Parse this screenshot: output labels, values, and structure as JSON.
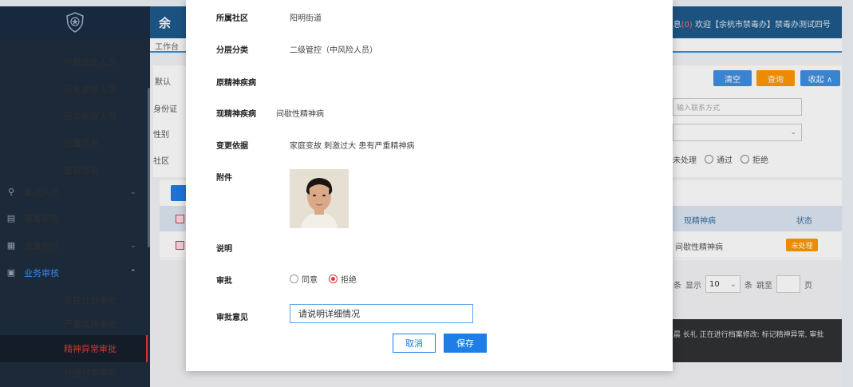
{
  "header": {
    "brand_partial": "余",
    "user_info_prefix": "息",
    "user_info_count": "(0)",
    "user_info": "欢迎【余杭市禁毒办】禁毒办测试四号"
  },
  "breadcrumb": {
    "label": "工作台"
  },
  "sidebar": {
    "items": [
      {
        "label": "户籍迁出人员",
        "kind": "sub"
      },
      {
        "label": "历年复吸人员",
        "kind": "sub"
      },
      {
        "label": "历年新增人员",
        "kind": "sub"
      },
      {
        "label": "处置信息",
        "kind": "sub"
      },
      {
        "label": "查获信息",
        "kind": "sub"
      },
      {
        "label": "重点人员",
        "kind": "top",
        "icon": "person-icon"
      },
      {
        "label": "戒毒管理",
        "kind": "top",
        "icon": "document-icon"
      },
      {
        "label": "戒毒管控",
        "kind": "top",
        "icon": "list-icon"
      },
      {
        "label": "业务审核",
        "kind": "top",
        "icon": "audit-icon"
      },
      {
        "label": "管控计划审批",
        "kind": "sub"
      },
      {
        "label": "严重疾病审批",
        "kind": "sub"
      },
      {
        "label": "精神异常审批",
        "kind": "sub"
      },
      {
        "label": "分层分类审批",
        "kind": "sub"
      }
    ]
  },
  "search": {
    "default_label": "默认",
    "id_label": "身份证",
    "gender_label": "性别",
    "community_label": "社区",
    "contact_placeholder": "输入联系方式",
    "clear_label": "清空",
    "query_label": "查询",
    "collapse_label": "收起 ∧",
    "status_options": [
      "未处理",
      "通过",
      "拒绝"
    ]
  },
  "table": {
    "columns": [
      "现精神病",
      "状态"
    ],
    "rows": [
      {
        "disease": "间歇性精神病",
        "status": "未处理"
      }
    ]
  },
  "pager": {
    "items_label": "条",
    "show_label": "显示",
    "page_size": "10",
    "items_label2": "条",
    "goto_label": "跳至",
    "page_label": "页"
  },
  "toast": {
    "text": "晨 长礼 正在进行档案修改: 标记精神异常, 审批"
  },
  "modal": {
    "fields": [
      {
        "label": "所属社区",
        "value": "阳明街道"
      },
      {
        "label": "分层分类",
        "value": "二级管控（中风险人员）"
      },
      {
        "label": "原精神疾病",
        "value": ""
      },
      {
        "label": "现精神疾病",
        "value": "间歇性精神病"
      },
      {
        "label": "变更依据",
        "value": "家庭变故 刺激过大 患有严重精神病"
      }
    ],
    "attachment_label": "附件",
    "note_label": "说明",
    "approve_label": "审批",
    "approve_options": {
      "agree": "同意",
      "reject": "拒绝",
      "selected": "reject"
    },
    "opinion_label": "审批意见",
    "opinion_value": "请说明详细情况",
    "cancel_label": "取消",
    "save_label": "保存"
  },
  "colors": {
    "primary": "#1f7de6",
    "danger": "#e03a3a",
    "warning": "#ff9800",
    "sidebar": "#1f2d3d"
  }
}
